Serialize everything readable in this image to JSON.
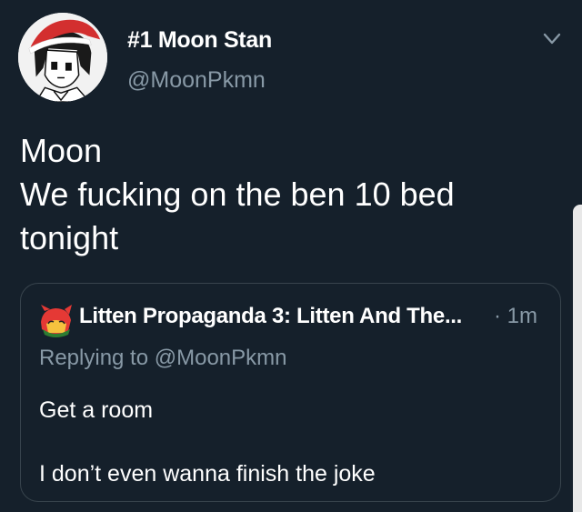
{
  "author": {
    "display_name": "#1 Moon Stan",
    "handle": "@MoonPkmn",
    "avatar_icon": "christmas-hat-avatar-icon"
  },
  "tweet": {
    "lines": [
      "Moon",
      "We fucking on the ben 10 bed",
      "tonight"
    ]
  },
  "quoted_tweet": {
    "name": "Litten Propaganda 3: Litten And The...",
    "time": "· 1m",
    "reply_prefix": "Replying to ",
    "reply_mention": "@MoonPkmn",
    "line1": "Get a room",
    "line2": "I don’t even wanna finish the joke",
    "avatar_icon": "litten-avatar-icon"
  },
  "menu_icon": "chevron-down-icon",
  "colors": {
    "background": "#15202b",
    "text": "#ffffff",
    "secondary": "#8899a6",
    "border": "#38444d"
  }
}
